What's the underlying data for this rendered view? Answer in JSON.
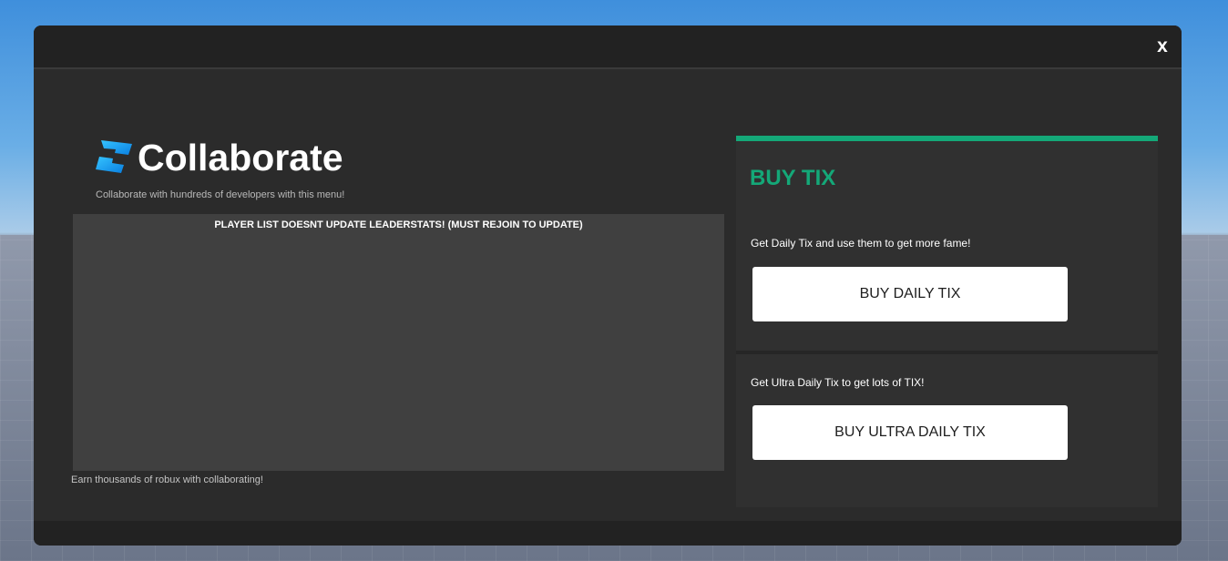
{
  "window": {
    "close_label": "x"
  },
  "brand": {
    "name": "Collaborate",
    "logo_icon": "roblox-studio-logo-icon",
    "subtitle": "Collaborate with hundreds of developers with this menu!"
  },
  "player_list": {
    "notice": "PLAYER LIST DOESNT UPDATE LEADERSTATS! (MUST REJOIN TO UPDATE)"
  },
  "footer_note": "Earn thousands of robux with collaborating!",
  "shop": {
    "title": "BUY TIX",
    "accent_color": "#14a878",
    "offers": [
      {
        "description": "Get Daily Tix and use them to get more fame!",
        "button_label": "BUY DAILY TIX"
      },
      {
        "description": "Get Ultra Daily Tix to get lots of TIX!",
        "button_label": "BUY ULTRA DAILY TIX"
      }
    ]
  }
}
